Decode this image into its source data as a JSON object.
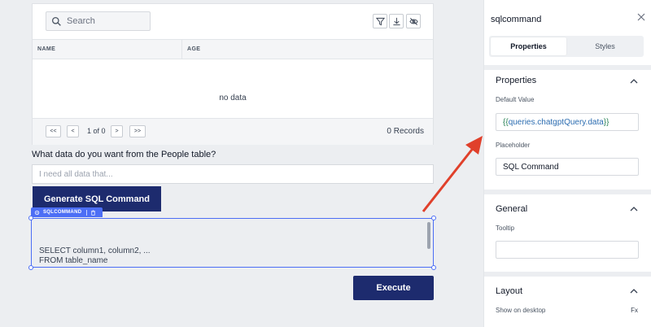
{
  "table": {
    "search_placeholder": "Search",
    "columns": [
      "NAME",
      "AGE"
    ],
    "empty_text": "no data",
    "pagination": {
      "first": "<<",
      "prev": "<",
      "info": "1 of 0",
      "next": ">",
      "last": ">>"
    },
    "records": "0 Records"
  },
  "question_label": "What data do you want from the People table?",
  "prompt_placeholder": "I need all data that...",
  "generate_button": "Generate SQL Command",
  "component_tag": "SQLCOMMAND",
  "sql_text": [
    "SELECT column1, column2, ...",
    "FROM table_name"
  ],
  "execute_button": "Execute",
  "panel": {
    "title": "sqlcommand",
    "tabs": [
      "Properties",
      "Styles"
    ],
    "properties_section": "Properties",
    "default_value_label": "Default Value",
    "default_value": {
      "open": "{{",
      "expr": "queries.chatgptQuery.data",
      "close": "}}"
    },
    "placeholder_label": "Placeholder",
    "placeholder_value": "SQL Command",
    "general_section": "General",
    "tooltip_label": "Tooltip",
    "layout_section": "Layout",
    "show_on_desktop_label": "Show on desktop",
    "fx_label": "Fx"
  },
  "colors": {
    "primary_button": "#1d2b6e",
    "selection": "#4c6ef5",
    "arrow": "#e0402b"
  }
}
